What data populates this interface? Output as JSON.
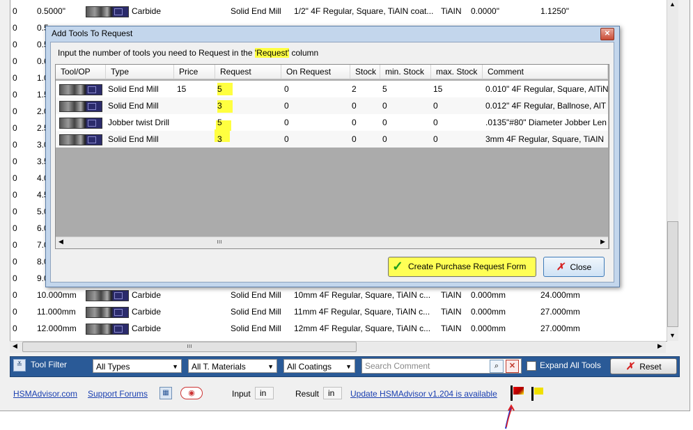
{
  "background_rows": [
    {
      "c0": "0",
      "c1": "0.5000\"",
      "material": "Carbide",
      "type": "Solid End Mill",
      "comment": "1/2\" 4F Regular, Square, TiAIN coat...",
      "coating": "TiAIN",
      "v1": "0.0000\"",
      "v2": "1.1250\""
    },
    {
      "c0": "0",
      "c1": "0.5"
    },
    {
      "c0": "0",
      "c1": "0.5"
    },
    {
      "c0": "0",
      "c1": "0.6"
    },
    {
      "c0": "0",
      "c1": "1.0"
    },
    {
      "c0": "0",
      "c1": "1.5"
    },
    {
      "c0": "0",
      "c1": "2.0"
    },
    {
      "c0": "0",
      "c1": "2.5"
    },
    {
      "c0": "0",
      "c1": "3.0"
    },
    {
      "c0": "0",
      "c1": "3.5"
    },
    {
      "c0": "0",
      "c1": "4.0"
    },
    {
      "c0": "0",
      "c1": "4.5"
    },
    {
      "c0": "0",
      "c1": "5.0"
    },
    {
      "c0": "0",
      "c1": "6.0"
    },
    {
      "c0": "0",
      "c1": "7.0"
    },
    {
      "c0": "0",
      "c1": "8.0"
    },
    {
      "c0": "0",
      "c1": "9.0"
    },
    {
      "c0": "0",
      "c1": "10.000mm",
      "material": "Carbide",
      "type": "Solid End Mill",
      "comment": "10mm  4F Regular, Square, TiAIN c...",
      "coating": "TiAIN",
      "v1": "0.000mm",
      "v2": "24.000mm"
    },
    {
      "c0": "0",
      "c1": "11.000mm",
      "material": "Carbide",
      "type": "Solid End Mill",
      "comment": "11mm  4F Regular, Square, TiAIN c...",
      "coating": "TiAIN",
      "v1": "0.000mm",
      "v2": "27.000mm"
    },
    {
      "c0": "0",
      "c1": "12.000mm",
      "material": "Carbide",
      "type": "Solid End Mill",
      "comment": "12mm  4F Regular, Square, TiAIN c...",
      "coating": "TiAIN",
      "v1": "0.000mm",
      "v2": "27.000mm"
    }
  ],
  "filter_bar": {
    "label": "Tool Filter",
    "types": "All Types",
    "materials": "All T. Materials",
    "coatings": "All Coatings",
    "search_placeholder": "Search Comment",
    "expand_label": "Expand All Tools",
    "reset_label": "Reset"
  },
  "status_bar": {
    "site_link": "HSMAdvisor.com",
    "forums_link": "Support Forums",
    "input_label": "Input",
    "input_unit": "in",
    "result_label": "Result",
    "result_unit": "in",
    "update_link": "Update HSMAdvisor v1.204 is available"
  },
  "dialog": {
    "title": "Add Tools To Request",
    "instruction_pre": "Input the number of tools you need to Request in the ",
    "instruction_hl": "'Request'",
    "instruction_post": " column",
    "columns": [
      "Tool/OP",
      "Type",
      "Price",
      "Request",
      "On Request",
      "Stock",
      "min. Stock",
      "max. Stock",
      "Comment"
    ],
    "rows": [
      {
        "type": "Solid End Mill",
        "price": "15",
        "request": "5",
        "on_request": "0",
        "stock": "2",
        "min": "5",
        "max": "15",
        "comment": "0.010\" 4F Regular, Square, AlTiN"
      },
      {
        "type": "Solid End Mill",
        "price": "",
        "request": "3",
        "on_request": "0",
        "stock": "0",
        "min": "0",
        "max": "0",
        "comment": "0.012\" 4F Regular, Ballnose, AlT"
      },
      {
        "type": "Jobber twist Drill",
        "price": "",
        "request": "5",
        "on_request": "0",
        "stock": "0",
        "min": "0",
        "max": "0",
        "comment": ".0135\"#80\" Diameter Jobber Len"
      },
      {
        "type": "Solid End Mill",
        "price": "",
        "request": "3",
        "on_request": "0",
        "stock": "0",
        "min": "0",
        "max": "0",
        "comment": "3mm 4F Regular, Square, TiAIN"
      }
    ],
    "create_label": "Create Purchase Request Form",
    "close_label": "Close"
  },
  "colors": {
    "highlight": "#ffff40",
    "filter_bar": "#2a5a97",
    "link": "#1a3fb0"
  }
}
